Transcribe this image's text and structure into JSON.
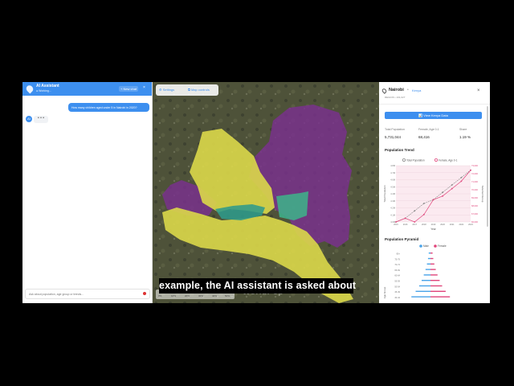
{
  "chat": {
    "title": "AI Assistant",
    "status": "● Working...",
    "new_chat": "+ New chat",
    "close": "×",
    "user_message": "How many children aged under 5 in Nairobi in 2020?",
    "bot_avatar": "AI",
    "typing": "• • •",
    "input_placeholder": "Ask about population, age group or trends..."
  },
  "map": {
    "toolbar": {
      "settings": "⚙ Settings",
      "layers": "⧉ Map controls"
    },
    "legend_ticks": [
      "0%",
      "10%",
      "20%",
      "30%",
      "40%",
      "50%"
    ],
    "watermark": "WorldPop",
    "colors": {
      "yellow": "#dcd84a",
      "purple": "#7a2f8f",
      "teal": "#2f9a8a"
    }
  },
  "info": {
    "region_name": "Nairobi",
    "separator": "•",
    "country": "Kenya",
    "region_type": "REGION • 101,027",
    "close": "×",
    "view_button": "📊 View Kenya Data",
    "stats": [
      {
        "label": "Total Population",
        "value": "5,731,044"
      },
      {
        "label": "Female, Age 0-1",
        "value": "68,416"
      },
      {
        "label": "Share",
        "value": "1.19 %"
      }
    ],
    "trend_title": "Population Trend",
    "pyramid_title": "Population Pyramid"
  },
  "chart_data": [
    {
      "type": "line",
      "title": "Population Trend",
      "xlabel": "Year",
      "ylabel": "Total Population",
      "y2label": "Selected Group",
      "x": [
        "2015",
        "2016",
        "2017",
        "2018",
        "2019",
        "2020",
        "2021",
        "2022",
        "2023"
      ],
      "series": [
        {
          "name": "Total Population",
          "values": [
            4.0,
            4.1,
            4.3,
            4.5,
            4.6,
            4.8,
            5.0,
            5.2,
            5.4
          ]
        },
        {
          "name": "Female, Age 0-1",
          "values": [
            4.0,
            4.1,
            4.0,
            4.2,
            4.6,
            4.7,
            4.9,
            5.1,
            5.4
          ]
        }
      ],
      "y_ticks": [
        "4.0M",
        "4.1M",
        "4.2M",
        "4.3M",
        "4.4M",
        "4.5M",
        "4.6M",
        "4.7M",
        "4.8M"
      ],
      "y2_ticks": [
        "66,000",
        "67,000",
        "68,000",
        "69,000",
        "70,000",
        "71,000",
        "72,000",
        "73,000"
      ],
      "colors": {
        "Total Population": "#888888",
        "Female, Age 0-1": "#e0457b"
      }
    },
    {
      "type": "bar",
      "title": "Population Pyramid",
      "legend": [
        "Male",
        "Female"
      ],
      "ylabel": "Age Group",
      "categories": [
        "80+",
        "75-79",
        "70-74",
        "65-69",
        "60-64",
        "55-59",
        "50-54",
        "45-49",
        "40-44"
      ],
      "series": [
        {
          "name": "Male",
          "values": [
            0.5,
            0.7,
            1.0,
            1.4,
            1.9,
            2.5,
            3.2,
            4.2,
            5.4
          ]
        },
        {
          "name": "Female",
          "values": [
            0.6,
            0.8,
            1.1,
            1.5,
            2.0,
            2.6,
            3.3,
            4.3,
            5.5
          ]
        }
      ],
      "colors": {
        "Male": "#4aa3e8",
        "Female": "#e0457b"
      }
    }
  ],
  "caption": "example, the AI assistant is asked about"
}
